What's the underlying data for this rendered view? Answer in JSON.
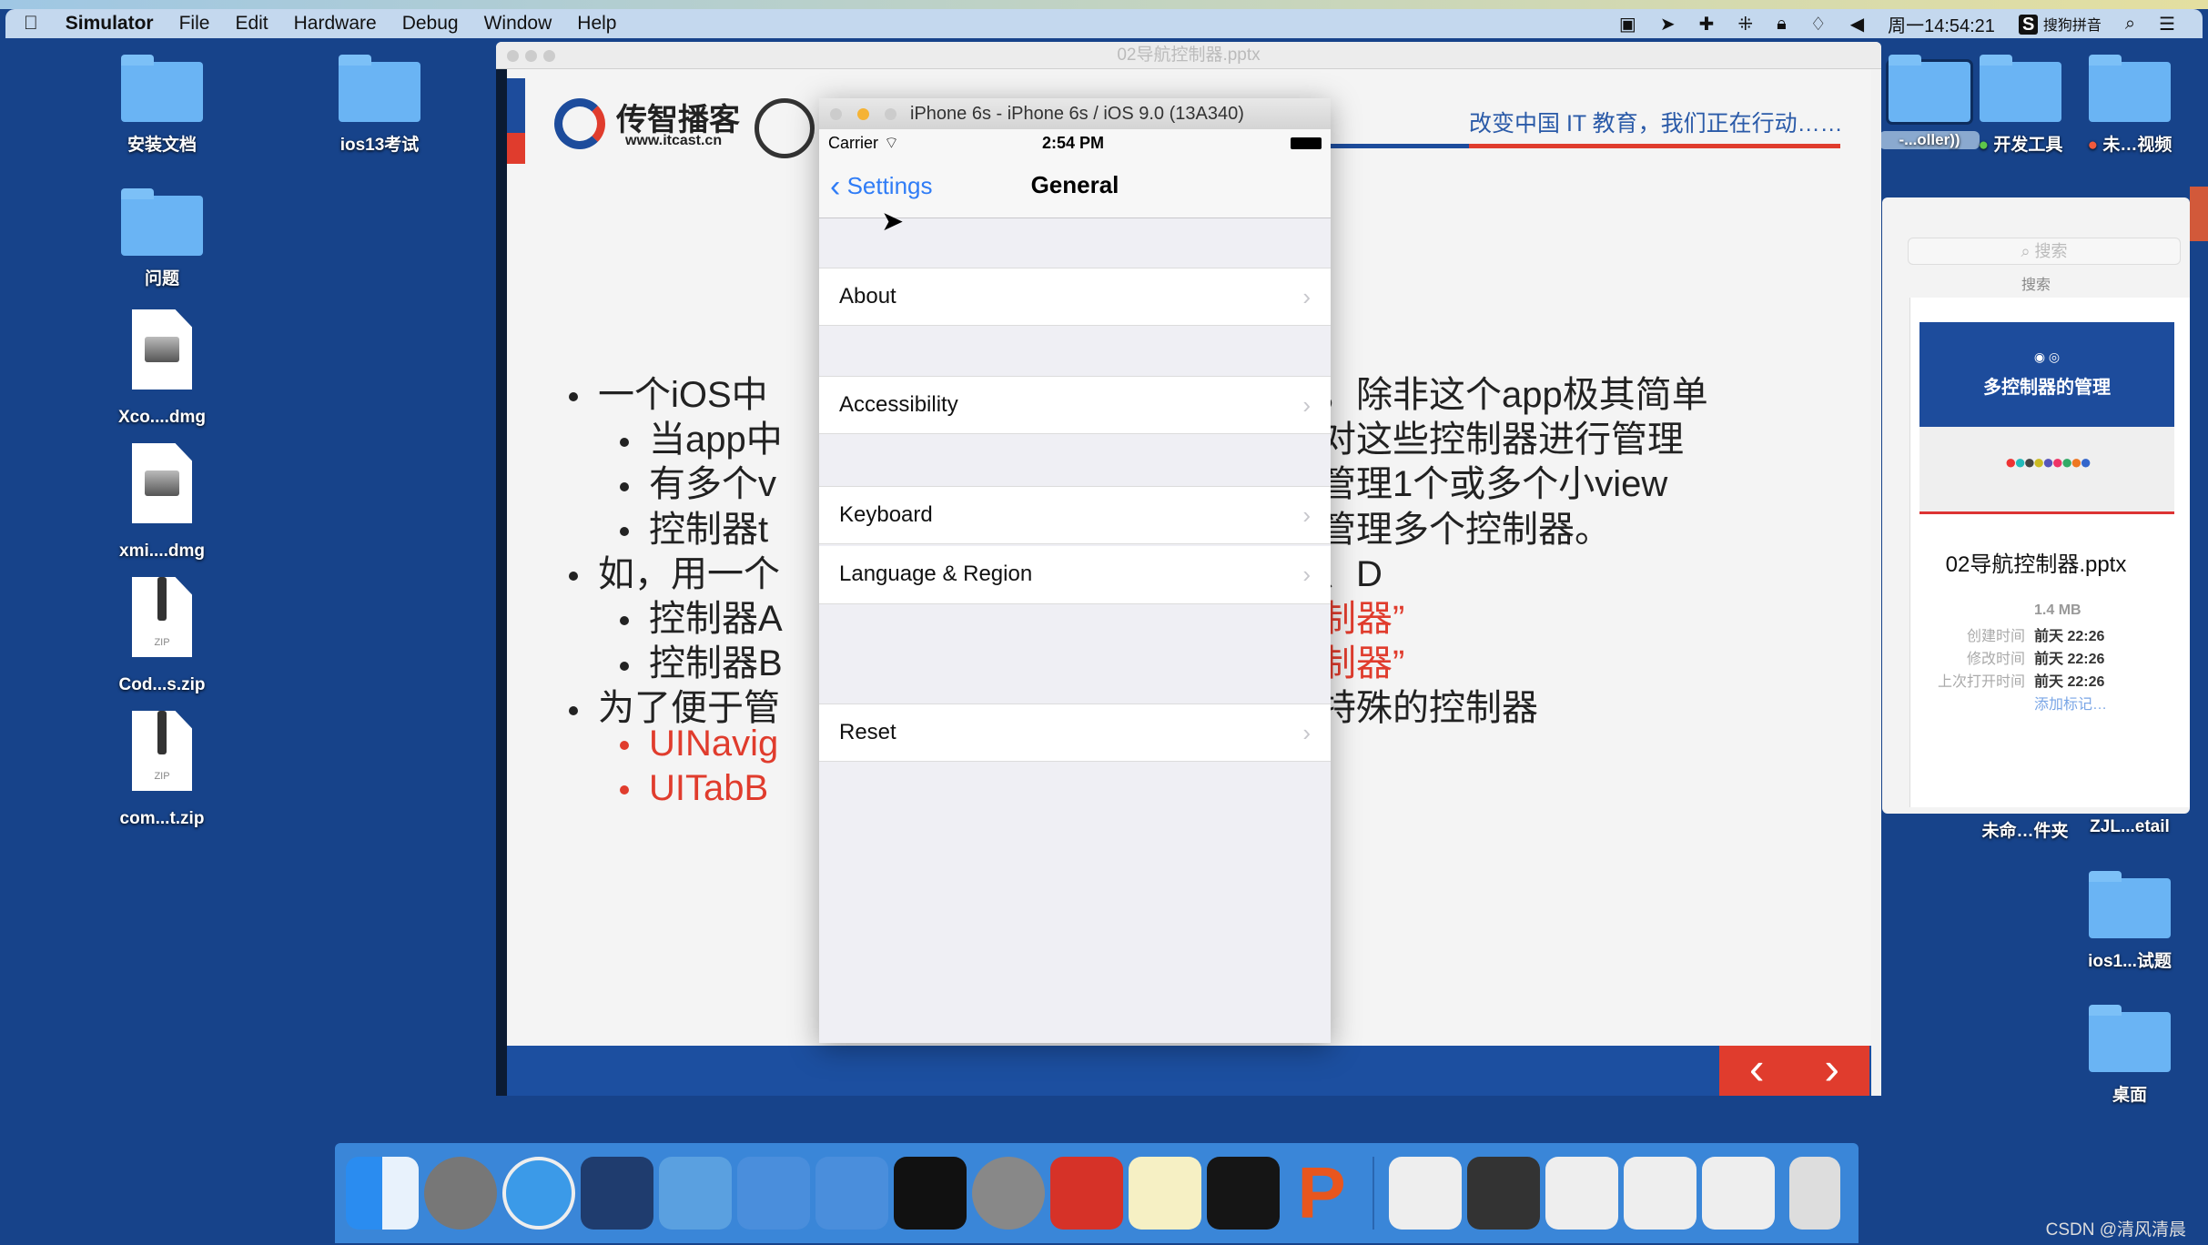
{
  "menubar": {
    "app": "Simulator",
    "items": [
      "File",
      "Edit",
      "Hardware",
      "Debug",
      "Window",
      "Help"
    ],
    "clock": "周一14:54:21",
    "ime": "搜狗拼音"
  },
  "desktop_left": [
    {
      "label": "安装文档",
      "type": "folder"
    },
    {
      "label": "ios13考试",
      "type": "folder"
    },
    {
      "label": "问题",
      "type": "folder"
    },
    {
      "label": "Xco....dmg",
      "type": "dmg"
    },
    {
      "label": "xmi....dmg",
      "type": "dmg"
    },
    {
      "label": "Cod...s.zip",
      "type": "zip"
    },
    {
      "label": "com...t.zip",
      "type": "zip"
    }
  ],
  "desktop_right": {
    "top_labels": [
      "-...oller))",
      "开发工具",
      "未…视频"
    ],
    "row2": [
      "未命…件夹",
      "ZJL...etail"
    ],
    "folders": [
      "ios1...试题",
      "桌面"
    ]
  },
  "ppt": {
    "title": "02导航控制器.pptx",
    "logo": "传智播客",
    "logo_url": "www.itcast.cn",
    "tagline": "改变中国 IT 教育，我们正在行动……",
    "lines": [
      {
        "left": "一个iOS中",
        "right": "，除非这个app极其简单",
        "level": 0
      },
      {
        "left": "当app中",
        "right": "对这些控制器进行管理",
        "level": 1
      },
      {
        "left": "有多个v",
        "right": "管理1个或多个小view",
        "level": 1
      },
      {
        "left": "控制器t",
        "right": "管理多个控制器。",
        "level": 1
      },
      {
        "left": "如，用一个",
        "right": "、D",
        "level": 0
      },
      {
        "left": "控制器A",
        "right": "制器”",
        "level": 1,
        "rightRed": true
      },
      {
        "left": "控制器B",
        "right": "制器”",
        "level": 1,
        "rightRed": true
      },
      {
        "left": "为了便于管",
        "right": "特殊的控制器",
        "level": 0
      },
      {
        "left": "UINavig",
        "right": "",
        "level": 1,
        "red": true
      },
      {
        "left": "UITabB",
        "right": "",
        "level": 1,
        "red": true
      }
    ],
    "prev": "‹",
    "next": "›"
  },
  "simulator": {
    "title": "iPhone 6s - iPhone 6s / iOS 9.0 (13A340)",
    "carrier": "Carrier",
    "time": "2:54 PM",
    "back": "Settings",
    "nav_title": "General",
    "rows": [
      "About",
      "Accessibility",
      "Keyboard",
      "Language & Region",
      "Reset"
    ]
  },
  "preview": {
    "search_placeholder": "搜索",
    "search_label": "搜索",
    "thumb_title": "多控制器的管理",
    "filename": "02导航控制器.pptx",
    "size": "1.4 MB",
    "meta": [
      {
        "k": "创建时间",
        "v": "前天 22:26"
      },
      {
        "k": "修改时间",
        "v": "前天 22:26"
      },
      {
        "k": "上次打开时间",
        "v": "前天 22:26"
      }
    ],
    "add_tag": "添加标记…"
  },
  "watermark": "CSDN @清风清晨",
  "colors": {
    "desktop": "#17438a",
    "accent_red": "#e03c2d",
    "ios_blue": "#2f7cf6",
    "dock": "#3a86d8"
  }
}
